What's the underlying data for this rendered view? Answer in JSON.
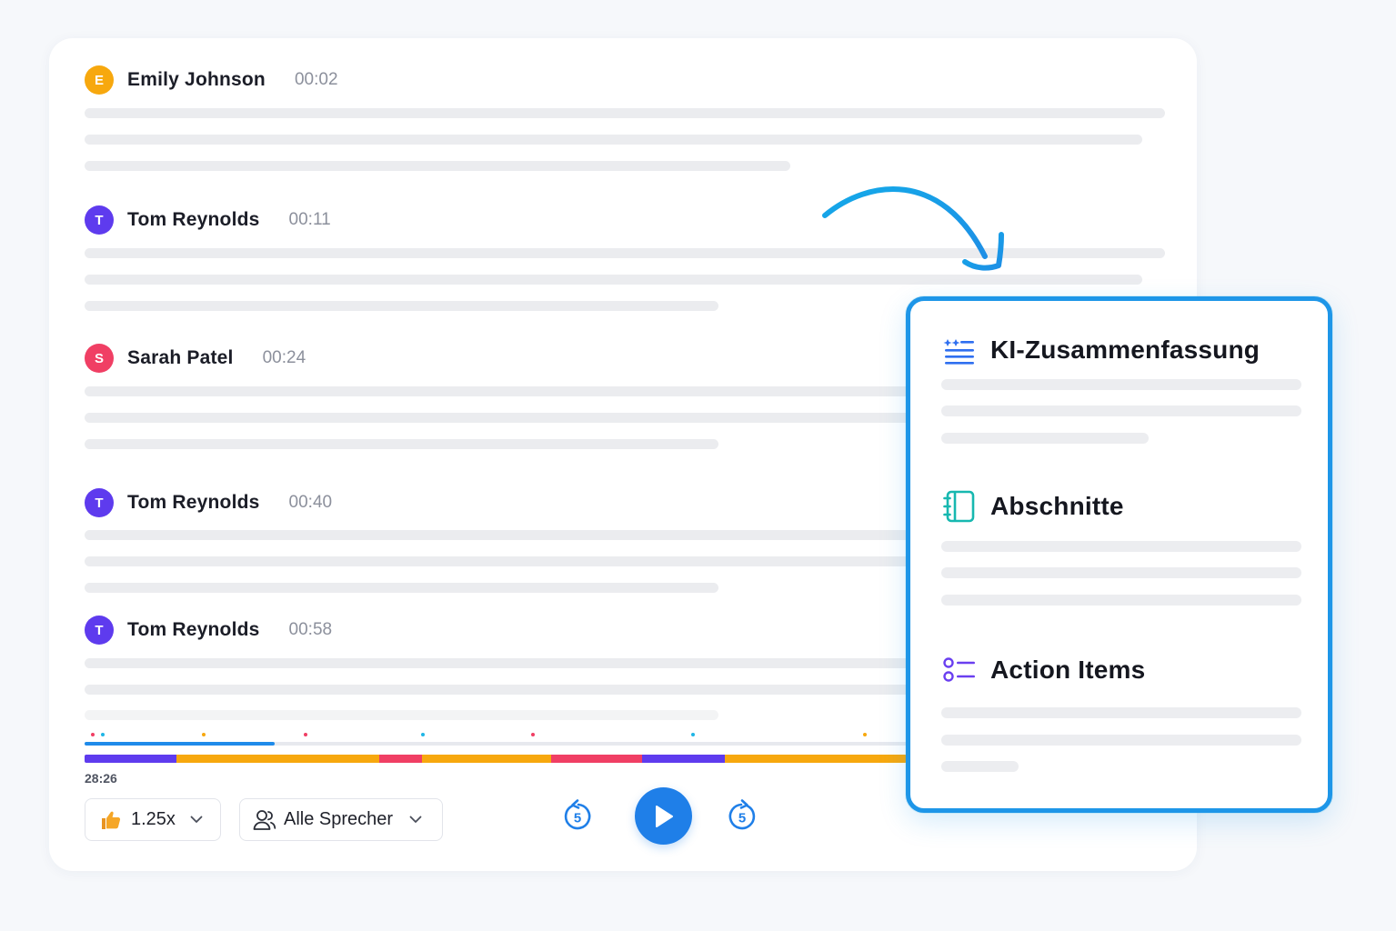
{
  "transcript": [
    {
      "initial": "E",
      "name": "Emily Johnson",
      "time": "00:02",
      "color": "#f7a80e"
    },
    {
      "initial": "T",
      "name": "Tom Reynolds",
      "time": "00:11",
      "color": "#5e3bee"
    },
    {
      "initial": "S",
      "name": "Sarah Patel",
      "time": "00:24",
      "color": "#f03f64"
    },
    {
      "initial": "T",
      "name": "Tom Reynolds",
      "time": "00:40",
      "color": "#5e3bee"
    },
    {
      "initial": "T",
      "name": "Tom Reynolds",
      "time": "00:58",
      "color": "#5e3bee"
    }
  ],
  "player": {
    "current_time": "28:26",
    "speed": "1.25x",
    "speaker_filter": "Alle Sprecher",
    "rewind_seconds": "5",
    "forward_seconds": "5",
    "progress_fraction": 0.23
  },
  "panel": {
    "summary_title": "KI-Zusammenfassung",
    "sections_title": "Abschnitte",
    "actions_title": "Action Items"
  },
  "colors": {
    "accent_blue": "#1f7fe8",
    "panel_border": "#1e96e8",
    "orange": "#f7a80e",
    "purple": "#5e3bee",
    "pink": "#f03f64"
  }
}
